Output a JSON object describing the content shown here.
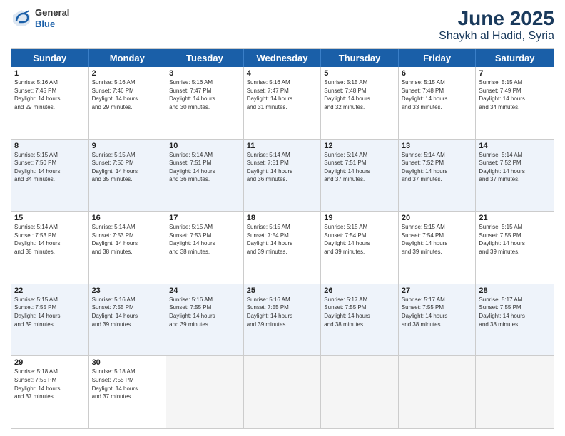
{
  "header": {
    "logo_general": "General",
    "logo_blue": "Blue",
    "title": "June 2025",
    "subtitle": "Shaykh al Hadid, Syria"
  },
  "days": [
    "Sunday",
    "Monday",
    "Tuesday",
    "Wednesday",
    "Thursday",
    "Friday",
    "Saturday"
  ],
  "rows": [
    [
      {
        "num": "",
        "data": ""
      },
      {
        "num": "",
        "data": ""
      },
      {
        "num": "",
        "data": ""
      },
      {
        "num": "",
        "data": ""
      },
      {
        "num": "",
        "data": ""
      },
      {
        "num": "",
        "data": ""
      },
      {
        "num": "",
        "data": ""
      }
    ],
    [
      {
        "num": "1",
        "data": "Sunrise: 5:16 AM\nSunset: 7:45 PM\nDaylight: 14 hours\nand 29 minutes."
      },
      {
        "num": "2",
        "data": "Sunrise: 5:16 AM\nSunset: 7:46 PM\nDaylight: 14 hours\nand 29 minutes."
      },
      {
        "num": "3",
        "data": "Sunrise: 5:16 AM\nSunset: 7:47 PM\nDaylight: 14 hours\nand 30 minutes."
      },
      {
        "num": "4",
        "data": "Sunrise: 5:16 AM\nSunset: 7:47 PM\nDaylight: 14 hours\nand 31 minutes."
      },
      {
        "num": "5",
        "data": "Sunrise: 5:15 AM\nSunset: 7:48 PM\nDaylight: 14 hours\nand 32 minutes."
      },
      {
        "num": "6",
        "data": "Sunrise: 5:15 AM\nSunset: 7:48 PM\nDaylight: 14 hours\nand 33 minutes."
      },
      {
        "num": "7",
        "data": "Sunrise: 5:15 AM\nSunset: 7:49 PM\nDaylight: 14 hours\nand 34 minutes."
      }
    ],
    [
      {
        "num": "8",
        "data": "Sunrise: 5:15 AM\nSunset: 7:50 PM\nDaylight: 14 hours\nand 34 minutes."
      },
      {
        "num": "9",
        "data": "Sunrise: 5:15 AM\nSunset: 7:50 PM\nDaylight: 14 hours\nand 35 minutes."
      },
      {
        "num": "10",
        "data": "Sunrise: 5:14 AM\nSunset: 7:51 PM\nDaylight: 14 hours\nand 36 minutes."
      },
      {
        "num": "11",
        "data": "Sunrise: 5:14 AM\nSunset: 7:51 PM\nDaylight: 14 hours\nand 36 minutes."
      },
      {
        "num": "12",
        "data": "Sunrise: 5:14 AM\nSunset: 7:51 PM\nDaylight: 14 hours\nand 37 minutes."
      },
      {
        "num": "13",
        "data": "Sunrise: 5:14 AM\nSunset: 7:52 PM\nDaylight: 14 hours\nand 37 minutes."
      },
      {
        "num": "14",
        "data": "Sunrise: 5:14 AM\nSunset: 7:52 PM\nDaylight: 14 hours\nand 37 minutes."
      }
    ],
    [
      {
        "num": "15",
        "data": "Sunrise: 5:14 AM\nSunset: 7:53 PM\nDaylight: 14 hours\nand 38 minutes."
      },
      {
        "num": "16",
        "data": "Sunrise: 5:14 AM\nSunset: 7:53 PM\nDaylight: 14 hours\nand 38 minutes."
      },
      {
        "num": "17",
        "data": "Sunrise: 5:15 AM\nSunset: 7:53 PM\nDaylight: 14 hours\nand 38 minutes."
      },
      {
        "num": "18",
        "data": "Sunrise: 5:15 AM\nSunset: 7:54 PM\nDaylight: 14 hours\nand 39 minutes."
      },
      {
        "num": "19",
        "data": "Sunrise: 5:15 AM\nSunset: 7:54 PM\nDaylight: 14 hours\nand 39 minutes."
      },
      {
        "num": "20",
        "data": "Sunrise: 5:15 AM\nSunset: 7:54 PM\nDaylight: 14 hours\nand 39 minutes."
      },
      {
        "num": "21",
        "data": "Sunrise: 5:15 AM\nSunset: 7:55 PM\nDaylight: 14 hours\nand 39 minutes."
      }
    ],
    [
      {
        "num": "22",
        "data": "Sunrise: 5:15 AM\nSunset: 7:55 PM\nDaylight: 14 hours\nand 39 minutes."
      },
      {
        "num": "23",
        "data": "Sunrise: 5:16 AM\nSunset: 7:55 PM\nDaylight: 14 hours\nand 39 minutes."
      },
      {
        "num": "24",
        "data": "Sunrise: 5:16 AM\nSunset: 7:55 PM\nDaylight: 14 hours\nand 39 minutes."
      },
      {
        "num": "25",
        "data": "Sunrise: 5:16 AM\nSunset: 7:55 PM\nDaylight: 14 hours\nand 39 minutes."
      },
      {
        "num": "26",
        "data": "Sunrise: 5:17 AM\nSunset: 7:55 PM\nDaylight: 14 hours\nand 38 minutes."
      },
      {
        "num": "27",
        "data": "Sunrise: 5:17 AM\nSunset: 7:55 PM\nDaylight: 14 hours\nand 38 minutes."
      },
      {
        "num": "28",
        "data": "Sunrise: 5:17 AM\nSunset: 7:55 PM\nDaylight: 14 hours\nand 38 minutes."
      }
    ],
    [
      {
        "num": "29",
        "data": "Sunrise: 5:18 AM\nSunset: 7:55 PM\nDaylight: 14 hours\nand 37 minutes."
      },
      {
        "num": "30",
        "data": "Sunrise: 5:18 AM\nSunset: 7:55 PM\nDaylight: 14 hours\nand 37 minutes."
      },
      {
        "num": "",
        "data": ""
      },
      {
        "num": "",
        "data": ""
      },
      {
        "num": "",
        "data": ""
      },
      {
        "num": "",
        "data": ""
      },
      {
        "num": "",
        "data": ""
      }
    ]
  ]
}
